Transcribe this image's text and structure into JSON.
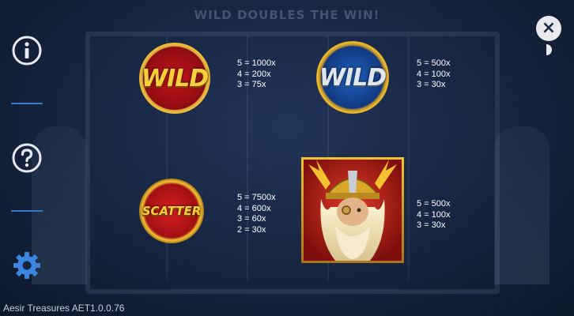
{
  "header": {
    "text": "WILD DOUBLES THE WIN!"
  },
  "sidebar": {
    "info_icon": "info-icon",
    "help_icon": "help-icon",
    "settings_icon": "gear-icon"
  },
  "close": {
    "icon": "close-icon",
    "symbol": "×"
  },
  "symbols": {
    "wild_gold": {
      "label": "WILD",
      "payouts": [
        "5 = 1000x",
        "4 = 200x",
        "3 = 75x"
      ]
    },
    "wild_silver": {
      "label": "WILD",
      "payouts": [
        "5 = 500x",
        "4 = 100x",
        "3 = 30x"
      ]
    },
    "scatter": {
      "label": "SCATTER",
      "payouts": [
        "5 = 7500x",
        "4 = 600x",
        "3 = 60x",
        "2 = 30x"
      ]
    },
    "odin": {
      "payouts": [
        "5 = 500x",
        "4 = 100x",
        "3 = 30x"
      ]
    }
  },
  "footer": {
    "version": "Aesir Treasures AET1.0.0.76"
  },
  "colors": {
    "background": "#16243f",
    "accent_divider": "#3a78c8",
    "gold": "#f2c230",
    "red": "#c4161c",
    "blue": "#1f5fbf"
  }
}
